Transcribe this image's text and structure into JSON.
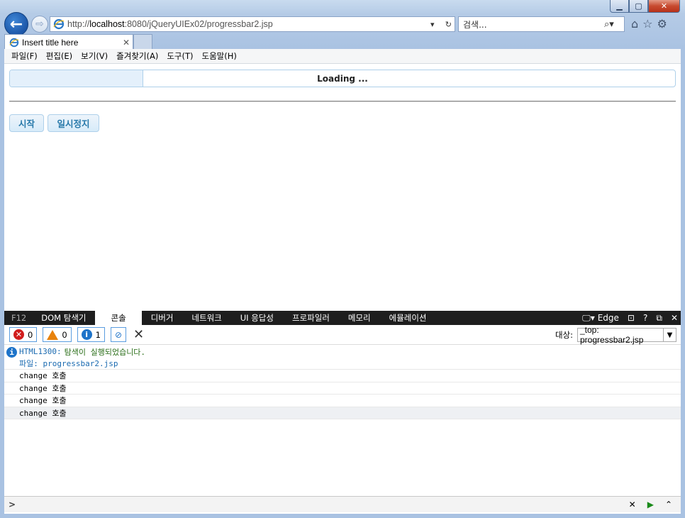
{
  "browser": {
    "address": {
      "prefix": "http://",
      "host": "localhost",
      "rest": ":8080/jQueryUIEx02/progressbar2.jsp"
    },
    "search_placeholder": "검색...",
    "tab_title": "Insert title here",
    "menu": [
      "파일(F)",
      "편집(E)",
      "보기(V)",
      "즐겨찾기(A)",
      "도구(T)",
      "도움말(H)"
    ]
  },
  "page": {
    "progress": {
      "label": "Loading ...",
      "value_fraction": 0.2
    },
    "buttons": {
      "start": "시작",
      "pause": "일시정지"
    }
  },
  "devtools": {
    "f12": "F12",
    "tabs": [
      "DOM 탐색기",
      "콘솔",
      "디버거",
      "네트워크",
      "UI 응답성",
      "프로파일러",
      "메모리",
      "에뮬레이션"
    ],
    "active_tab": "콘솔",
    "mode": "Edge",
    "counts": {
      "errors": "0",
      "warnings": "0",
      "info": "1"
    },
    "target_label": "대상:",
    "target_value": "_top: progressbar2.jsp",
    "message": {
      "code": "HTML1300:",
      "text": "탐색이 실행되었습니다.",
      "file": "파일: progressbar2.jsp"
    },
    "logs": [
      "change 호출",
      "change 호출",
      "change 호출",
      "change 호출"
    ],
    "prompt": ">"
  }
}
